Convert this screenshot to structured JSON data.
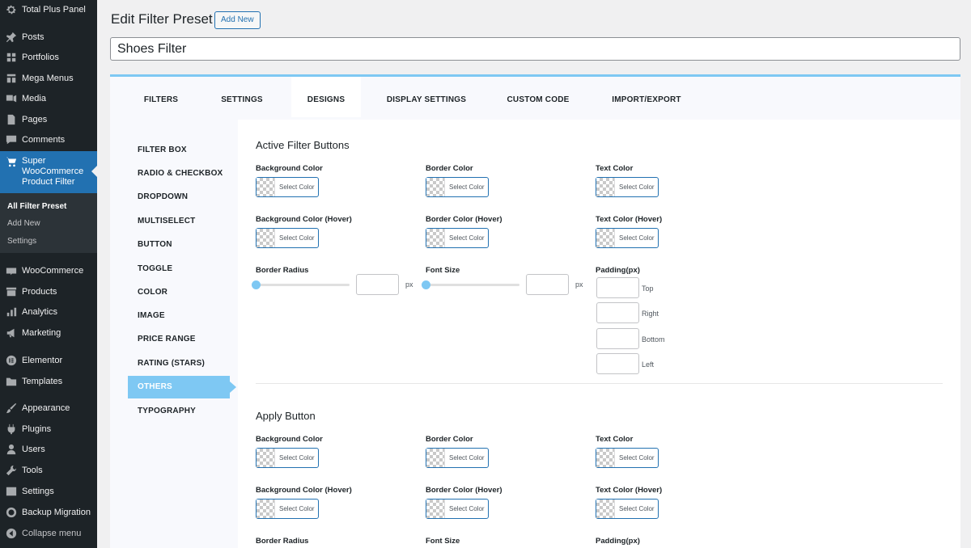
{
  "sidebar": {
    "brand": "Total Plus Panel",
    "items": [
      {
        "label": "Posts",
        "icon": "pin-icon"
      },
      {
        "label": "Portfolios",
        "icon": "grid-icon"
      },
      {
        "label": "Mega Menus",
        "icon": "grid-icon"
      },
      {
        "label": "Media",
        "icon": "media-icon"
      },
      {
        "label": "Pages",
        "icon": "page-icon"
      },
      {
        "label": "Comments",
        "icon": "comment-icon"
      }
    ],
    "active_item": {
      "label_line1": "Super",
      "label_line2": "WooCommerce",
      "label_line3": "Product Filter",
      "icon": "cart-icon"
    },
    "submenu": [
      "All Filter Preset",
      "Add New",
      "Settings"
    ],
    "items_after": [
      {
        "label": "WooCommerce",
        "icon": "woo-icon"
      },
      {
        "label": "Products",
        "icon": "archive-icon"
      },
      {
        "label": "Analytics",
        "icon": "chart-icon"
      },
      {
        "label": "Marketing",
        "icon": "megaphone-icon"
      },
      {
        "label": "Elementor",
        "icon": "elementor-icon"
      },
      {
        "label": "Templates",
        "icon": "folder-icon"
      },
      {
        "label": "Appearance",
        "icon": "brush-icon"
      },
      {
        "label": "Plugins",
        "icon": "plugin-icon"
      },
      {
        "label": "Users",
        "icon": "user-icon"
      },
      {
        "label": "Tools",
        "icon": "wrench-icon"
      },
      {
        "label": "Settings",
        "icon": "settings-icon"
      },
      {
        "label": "Backup Migration",
        "icon": "backup-icon"
      },
      {
        "label": "Collapse menu",
        "icon": "collapse-icon"
      }
    ]
  },
  "header": {
    "title": "Edit Filter Preset",
    "add_new": "Add New",
    "preset_name": "Shoes Filter"
  },
  "tabs": [
    "FILTERS",
    "SETTINGS",
    "DESIGNS",
    "DISPLAY SETTINGS",
    "CUSTOM CODE",
    "IMPORT/EXPORT"
  ],
  "active_tab": "DESIGNS",
  "design_nav": [
    "FILTER BOX",
    "RADIO & CHECKBOX",
    "DROPDOWN",
    "MULTISELECT",
    "BUTTON",
    "TOGGLE",
    "COLOR",
    "IMAGE",
    "PRICE RANGE",
    "RATING (STARS)",
    "OTHERS",
    "TYPOGRAPHY"
  ],
  "active_nav": "OTHERS",
  "sections": [
    {
      "title": "Active Filter Buttons",
      "colors": [
        "Background Color",
        "Border Color",
        "Text Color",
        "Background Color (Hover)",
        "Border Color (Hover)",
        "Text Color (Hover)"
      ],
      "select_color": "Select Color",
      "border_radius": "Border Radius",
      "font_size": "Font Size",
      "padding": "Padding(px)",
      "unit": "px",
      "padding_sides": [
        "Top",
        "Right",
        "Bottom",
        "Left"
      ]
    },
    {
      "title": "Apply Button",
      "colors": [
        "Background Color",
        "Border Color",
        "Text Color",
        "Background Color (Hover)",
        "Border Color (Hover)",
        "Text Color (Hover)"
      ],
      "select_color": "Select Color",
      "border_radius": "Border Radius",
      "font_size": "Font Size",
      "padding": "Padding(px)"
    }
  ],
  "colors": {
    "accent": "#7ec8f3",
    "wp_blue": "#2271b1",
    "sidebar_bg": "#1d2327"
  }
}
